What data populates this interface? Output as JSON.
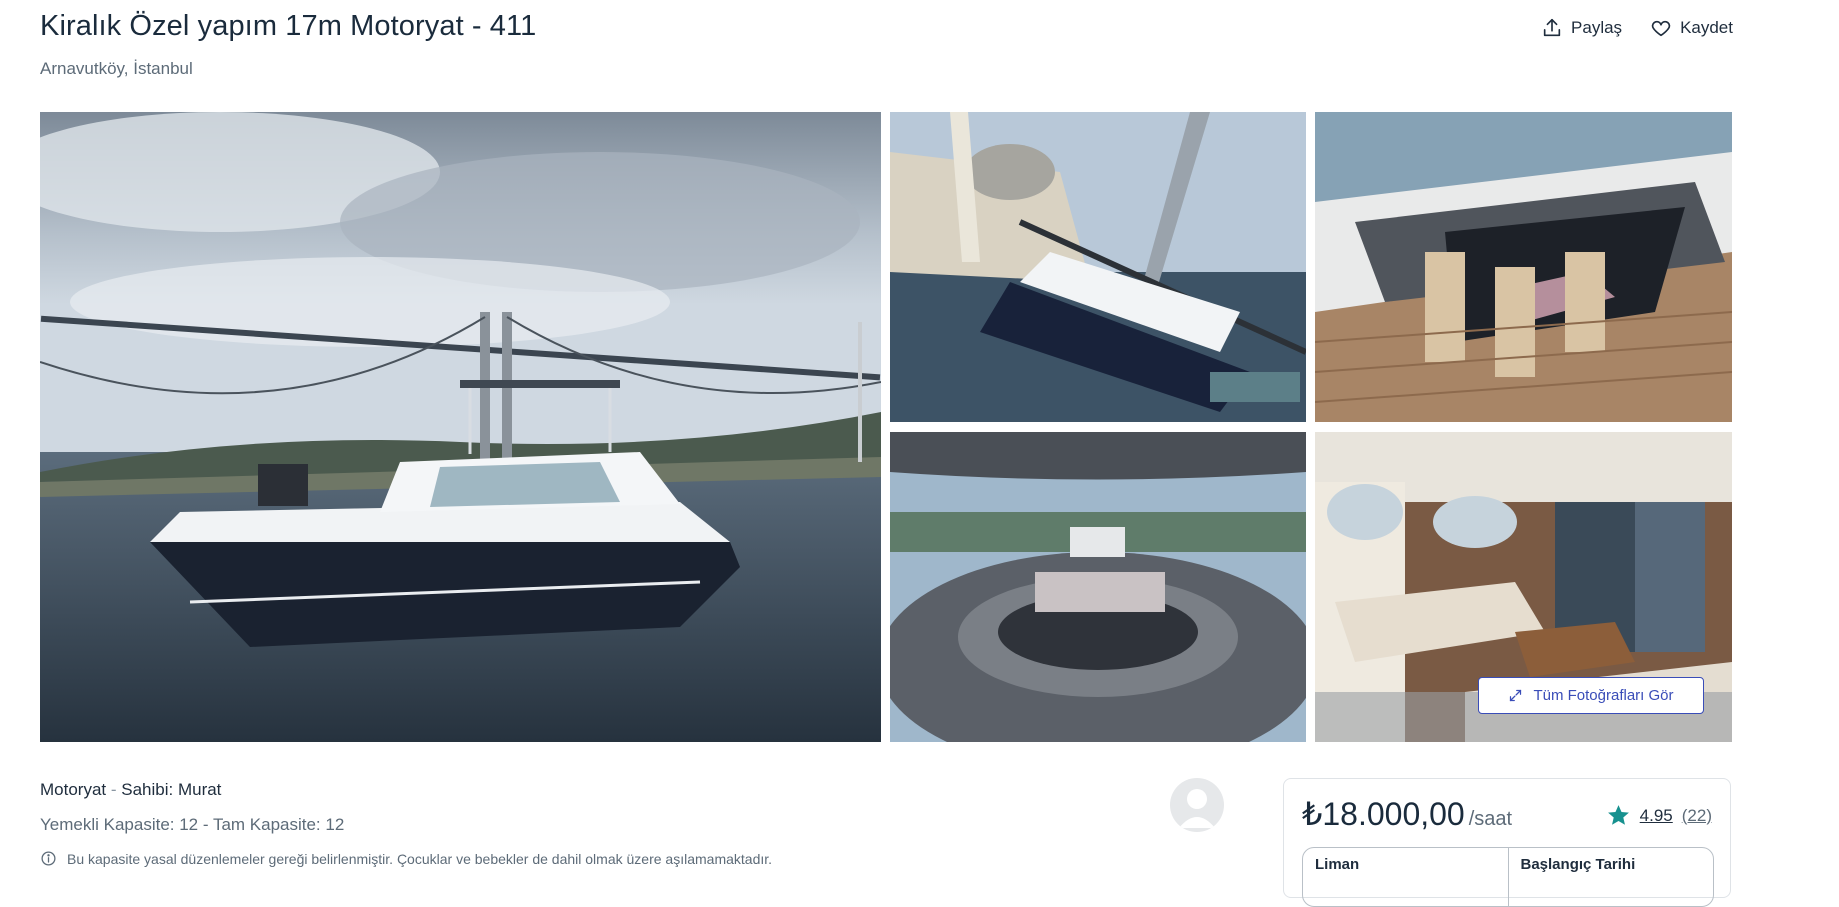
{
  "listing": {
    "title": "Kiralık Özel yapım 17m Motoryat - 411",
    "location": "Arnavutköy, İstanbul"
  },
  "actions": {
    "share_label": "Paylaş",
    "save_label": "Kaydet"
  },
  "gallery": {
    "all_photos_label": "Tüm Fotoğrafları Gör",
    "photos": [
      "main-yacht-bosphorus-photo",
      "yacht-mosque-bridge-photo",
      "deck-dining-table-photo",
      "flybridge-seating-photo",
      "salon-interior-photo"
    ]
  },
  "details": {
    "type": "Motoryat",
    "owner": "Sahibi: Murat",
    "capacity": "Yemekli Kapasite: 12 - Tam Kapasite: 12",
    "notice": "Bu kapasite yasal düzenlemeler gereği belirlenmiştir. Çocuklar ve bebekler de dahil olmak üzere aşılamamaktadır."
  },
  "booking": {
    "price": "₺18.000,00",
    "unit": "/saat",
    "rating": "4.95",
    "reviews": "(22)",
    "field_port": "Liman",
    "field_start_date": "Başlangıç Tarihi"
  },
  "colors": {
    "accent": "#3a4db8",
    "star": "#17918f",
    "text": "#1f2d3d",
    "muted": "#5d6b78"
  }
}
